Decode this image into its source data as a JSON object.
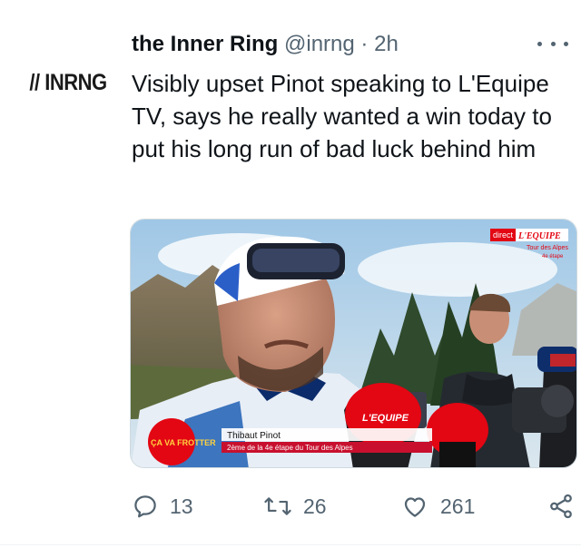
{
  "tweet": {
    "avatar_logo": "// INRNG",
    "display_name": "the Inner Ring",
    "handle": "@inrng",
    "separator": "·",
    "time": "2h",
    "text": "Visibly upset Pinot speaking to L'Equipe TV, says he really wanted a win today to put his long run of bad luck behind him"
  },
  "media": {
    "broadcast_badge_direct": "direct",
    "broadcast_badge_brand": "L'EQUIPE",
    "broadcast_caption_line1": "Tour des Alpes",
    "broadcast_caption_line2": "4e étape",
    "lower_third_name": "Thibaut Pinot",
    "lower_third_subtitle": "2ème de la 4e étape du Tour des Alpes",
    "mic_label": "L'EQUIPE",
    "sponsor_text": "ÇA VA FROTTER"
  },
  "actions": {
    "reply_count": "13",
    "retweet_count": "26",
    "like_count": "261"
  },
  "colors": {
    "text_primary": "#0f1419",
    "text_secondary": "#536471",
    "lequipe_red": "#e30613"
  },
  "icons": [
    "more-icon",
    "reply-icon",
    "retweet-icon",
    "like-icon",
    "share-icon"
  ]
}
